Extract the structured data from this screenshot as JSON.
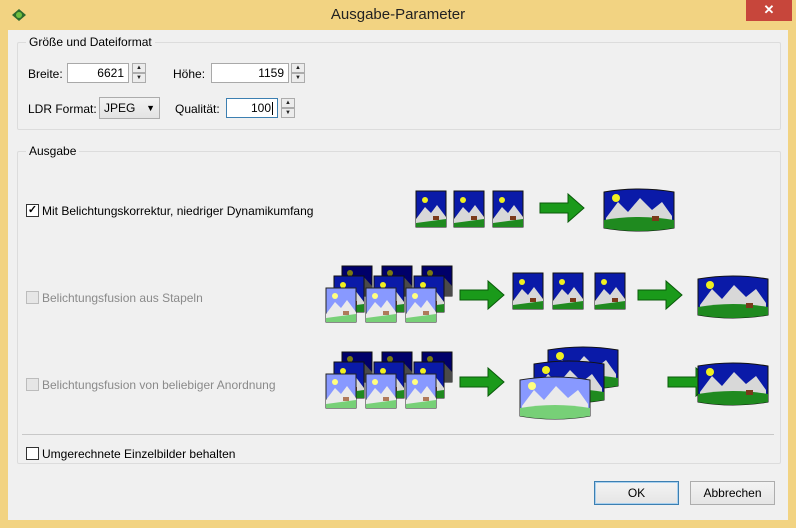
{
  "window": {
    "title": "Ausgabe-Parameter",
    "close_glyph": "✕"
  },
  "size_group": {
    "legend": "Größe und Dateiformat",
    "width_label": "Breite:",
    "width_value": "6621",
    "height_label": "Höhe:",
    "height_value": "1159",
    "ldr_label": "LDR Format:",
    "ldr_value": "JPEG",
    "quality_label": "Qualität:",
    "quality_value": "100"
  },
  "output_group": {
    "legend": "Ausgabe",
    "options": [
      {
        "label": "Mit Belichtungskorrektur, niedriger Dynamikumfang",
        "checked": true,
        "enabled": true
      },
      {
        "label": "Belichtungsfusion aus Stapeln",
        "checked": false,
        "enabled": false
      },
      {
        "label": "Belichtungsfusion von beliebiger Anordnung",
        "checked": false,
        "enabled": false
      }
    ],
    "keep_label": "Umgerechnete Einzelbilder behalten",
    "keep_checked": false
  },
  "buttons": {
    "ok": "OK",
    "cancel": "Abbrechen"
  },
  "colors": {
    "titlebar": "#f2d382",
    "sky": "#0a1aa8",
    "grass": "#1f8a1f",
    "arrow": "#1a9a1a",
    "focus": "#3c7fb1"
  }
}
